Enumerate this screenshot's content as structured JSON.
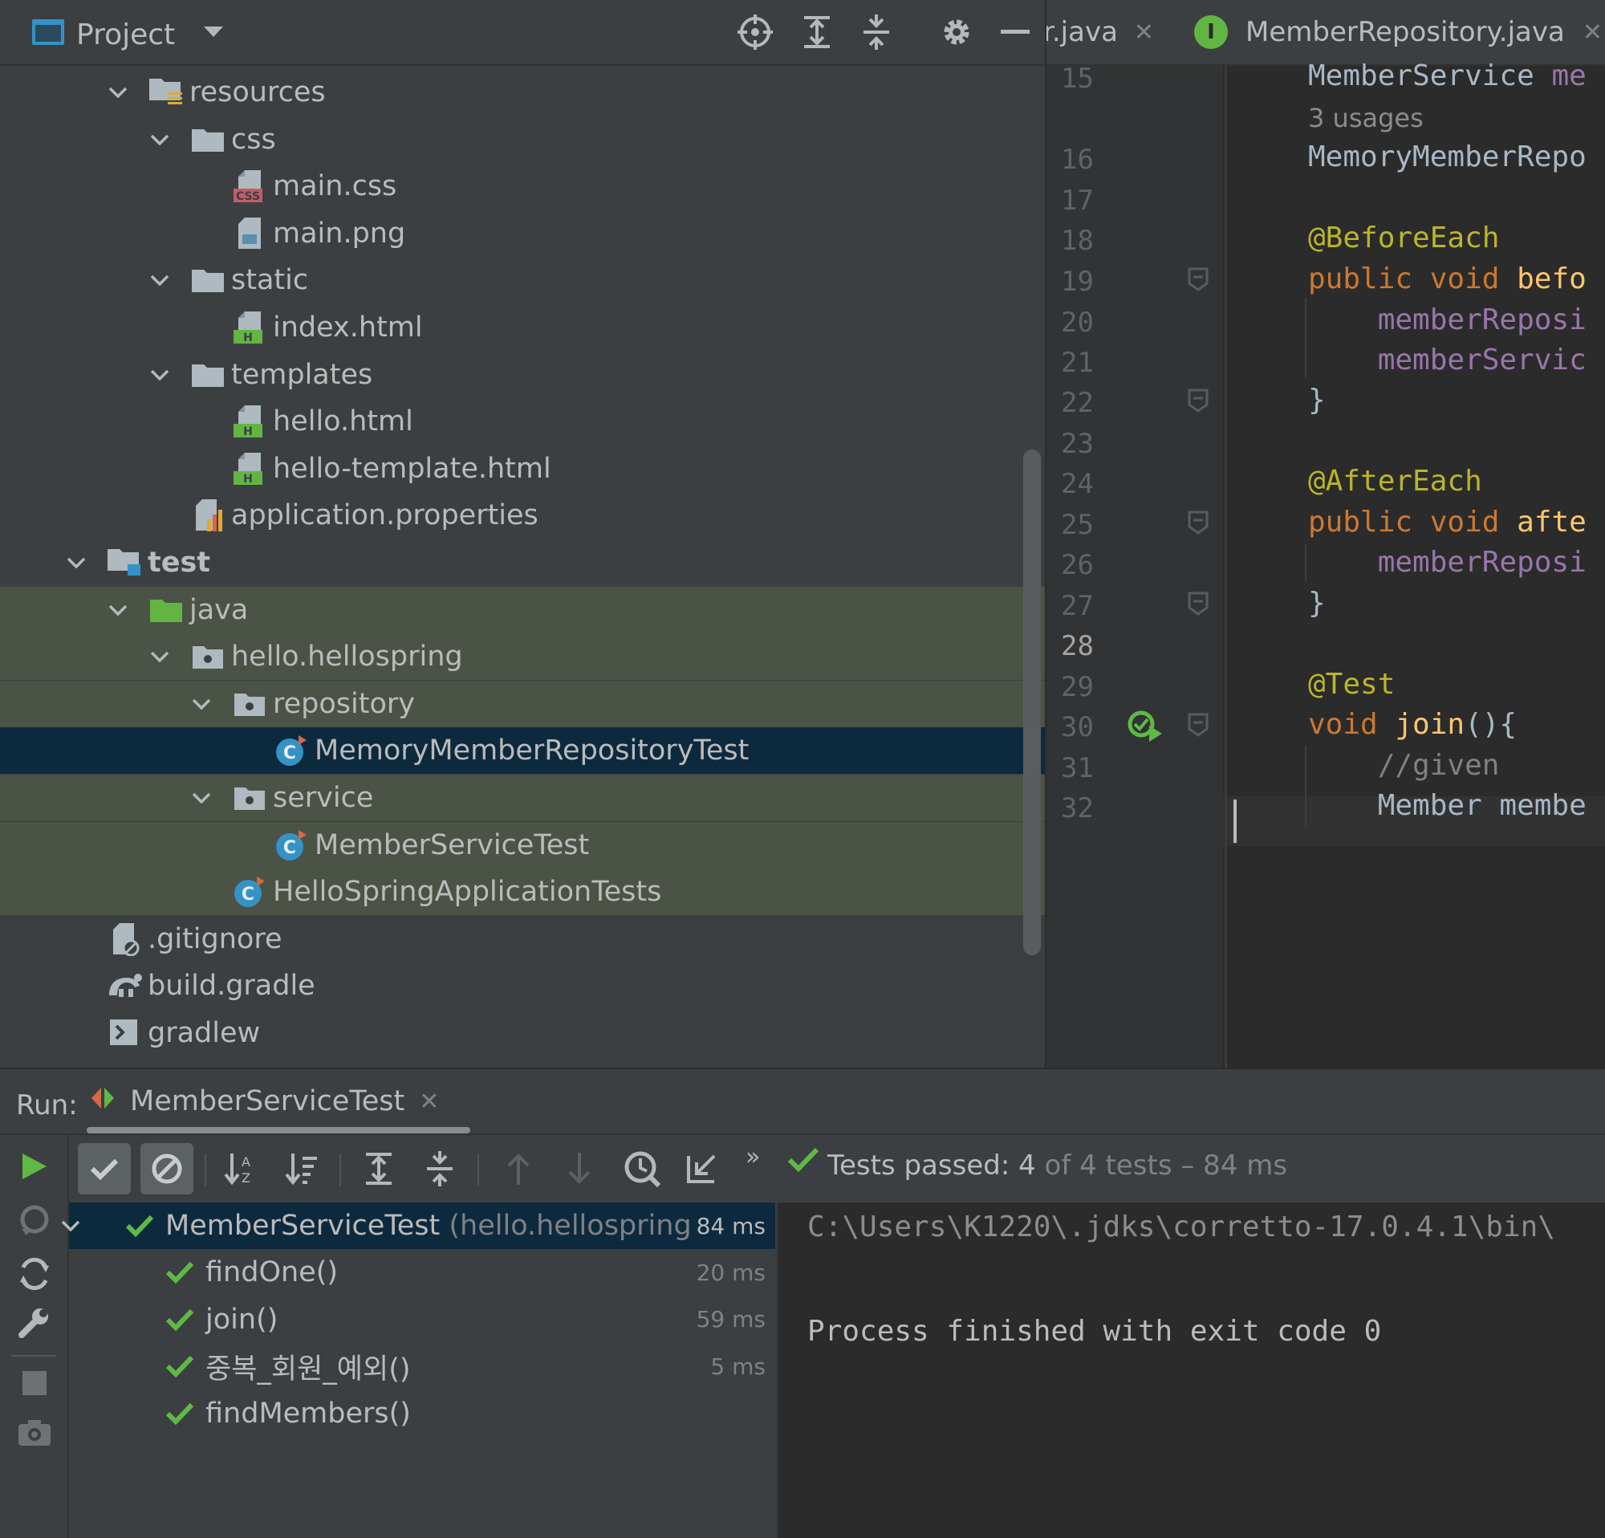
{
  "project_panel": {
    "title": "Project",
    "tree": [
      {
        "label": "resources",
        "bold": false
      },
      {
        "label": "css",
        "bold": false
      },
      {
        "label": "main.css",
        "bold": false
      },
      {
        "label": "main.png",
        "bold": false
      },
      {
        "label": "static",
        "bold": false
      },
      {
        "label": "index.html",
        "bold": false
      },
      {
        "label": "templates",
        "bold": false
      },
      {
        "label": "hello.html",
        "bold": false
      },
      {
        "label": "hello-template.html",
        "bold": false
      },
      {
        "label": "application.properties",
        "bold": false
      },
      {
        "label": "test",
        "bold": true
      },
      {
        "label": "java",
        "bold": false
      },
      {
        "label": "hello.hellospring",
        "bold": false
      },
      {
        "label": "repository",
        "bold": false
      },
      {
        "label": "MemoryMemberRepositoryTest",
        "bold": false
      },
      {
        "label": "service",
        "bold": false
      },
      {
        "label": "MemberServiceTest",
        "bold": false
      },
      {
        "label": "HelloSpringApplicationTests",
        "bold": false
      },
      {
        "label": ".gitignore",
        "bold": false
      },
      {
        "label": "build.gradle",
        "bold": false
      },
      {
        "label": "gradlew",
        "bold": false
      }
    ]
  },
  "editor": {
    "tabs": [
      {
        "label": "r.java",
        "icon": "java-class-icon"
      },
      {
        "label": "MemberRepository.java",
        "icon": "interface-icon"
      }
    ],
    "current_line": "28",
    "lines": [
      {
        "num": "15",
        "parts": [
          {
            "t": "MemberService ",
            "c": "#a9b7c6"
          },
          {
            "t": "me",
            "c": "#9876aa"
          }
        ]
      },
      {
        "num": "",
        "usage": "3 usages"
      },
      {
        "num": "16",
        "parts": [
          {
            "t": "MemoryMemberRepo",
            "c": "#a9b7c6"
          }
        ]
      },
      {
        "num": "17",
        "parts": []
      },
      {
        "num": "18",
        "parts": [
          {
            "t": "@BeforeEach",
            "c": "#bbb529"
          }
        ]
      },
      {
        "num": "19",
        "parts": [
          {
            "t": "public void ",
            "c": "#cc7832"
          },
          {
            "t": "befo",
            "c": "#ffc66d"
          }
        ]
      },
      {
        "num": "20",
        "parts": [
          {
            "t": "    memberReposi",
            "c": "#9876aa"
          }
        ]
      },
      {
        "num": "21",
        "parts": [
          {
            "t": "    memberServic",
            "c": "#9876aa"
          }
        ]
      },
      {
        "num": "22",
        "parts": [
          {
            "t": "}",
            "c": "#a9b7c6"
          }
        ]
      },
      {
        "num": "23",
        "parts": []
      },
      {
        "num": "24",
        "parts": [
          {
            "t": "@AfterEach",
            "c": "#bbb529"
          }
        ]
      },
      {
        "num": "25",
        "parts": [
          {
            "t": "public void ",
            "c": "#cc7832"
          },
          {
            "t": "afte",
            "c": "#ffc66d"
          }
        ]
      },
      {
        "num": "26",
        "parts": [
          {
            "t": "    memberReposi",
            "c": "#9876aa"
          }
        ]
      },
      {
        "num": "27",
        "parts": [
          {
            "t": "}",
            "c": "#a9b7c6"
          }
        ]
      },
      {
        "num": "28",
        "parts": []
      },
      {
        "num": "29",
        "parts": [
          {
            "t": "@Test",
            "c": "#bbb529"
          }
        ]
      },
      {
        "num": "30",
        "parts": [
          {
            "t": "void ",
            "c": "#cc7832"
          },
          {
            "t": "join",
            "c": "#ffc66d"
          },
          {
            "t": "(){",
            "c": "#a9b7c6"
          }
        ]
      },
      {
        "num": "31",
        "parts": [
          {
            "t": "    //given",
            "c": "#808080"
          }
        ]
      },
      {
        "num": "32",
        "parts": [
          {
            "t": "    Member membe",
            "c": "#a9b7c6"
          }
        ]
      }
    ]
  },
  "run_panel": {
    "label": "Run:",
    "tab_label": "MemberServiceTest",
    "status_prefix": "Tests passed: ",
    "status_count": "4",
    "status_suffix": " of 4 tests – 84 ms",
    "tests": [
      {
        "name": "MemberServiceTest",
        "detail": " (hello.hellospring.serv",
        "time": "84 ms"
      },
      {
        "name": "findOne()",
        "detail": "",
        "time": "20 ms"
      },
      {
        "name": "join()",
        "detail": "",
        "time": "59 ms"
      },
      {
        "name": "중복_회원_예외()",
        "detail": "",
        "time": "5 ms"
      },
      {
        "name": "findMembers()",
        "detail": "",
        "time": ""
      }
    ],
    "console": [
      "C:\\Users\\K1220\\.jdks\\corretto-17.0.4.1\\bin\\",
      "",
      "Process finished with exit code 0"
    ]
  },
  "colors": {
    "pass_green": "#5fb946",
    "selection": "#0d293e",
    "test_scope_bg": "#4b5246"
  }
}
